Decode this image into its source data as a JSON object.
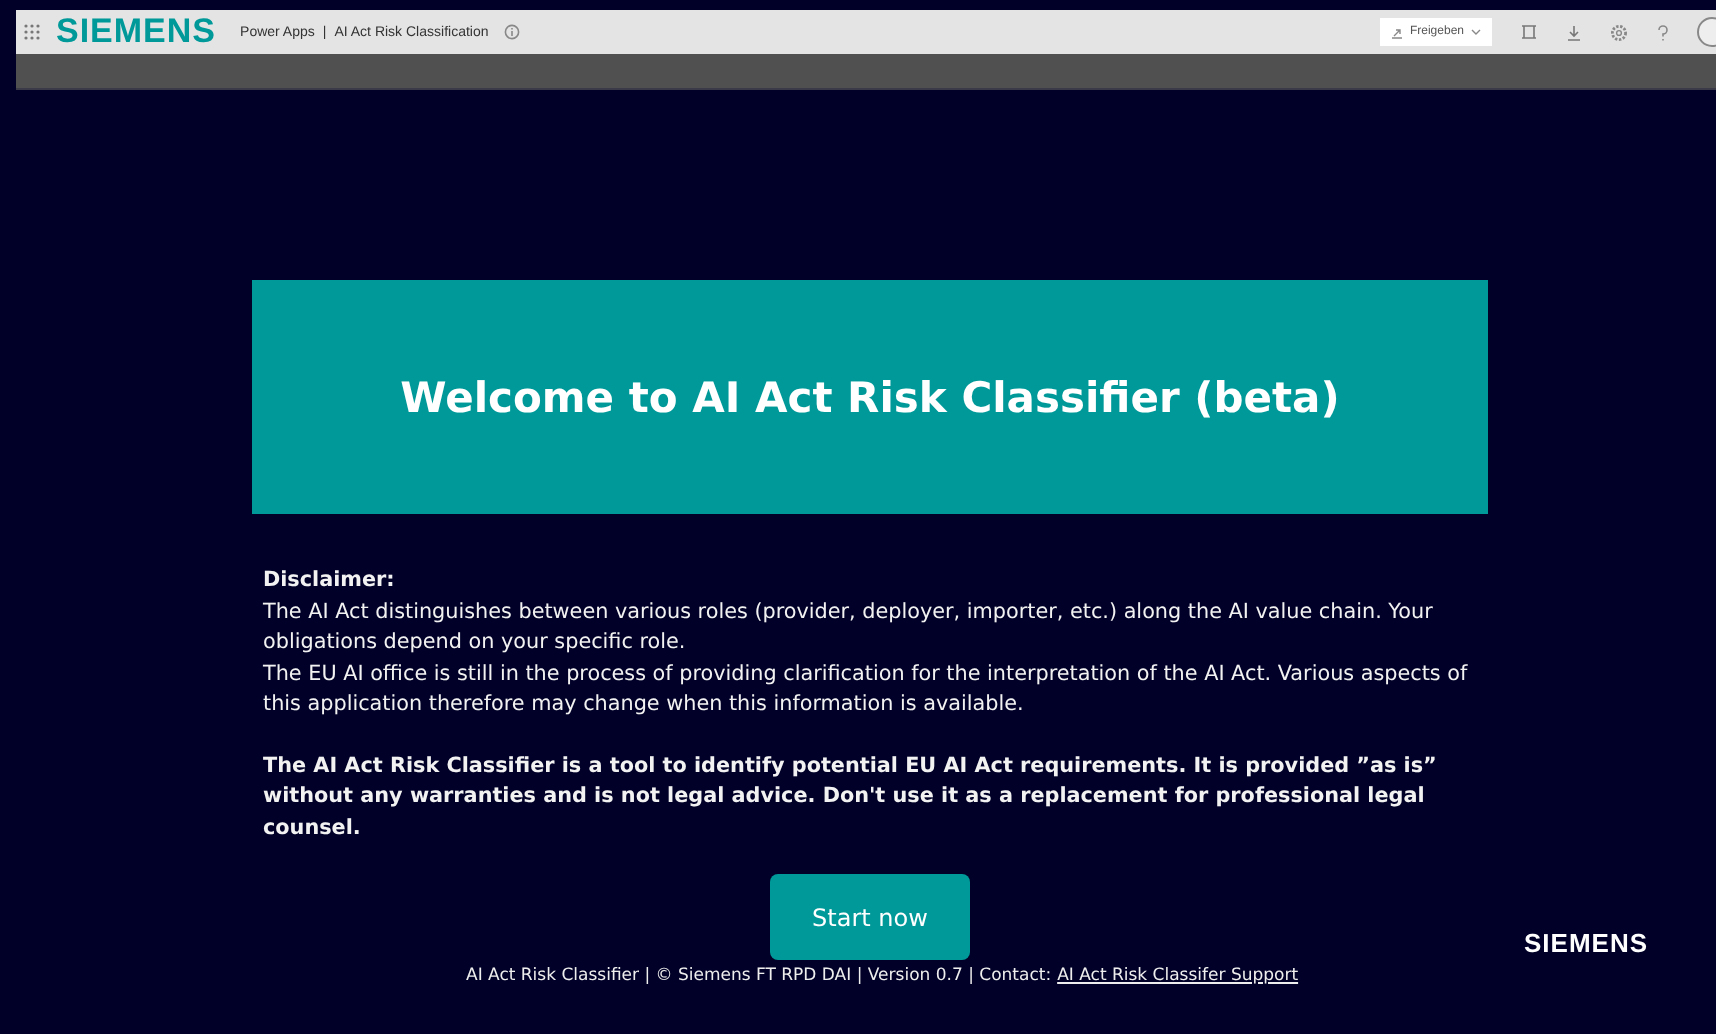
{
  "top_bar": {
    "logo": "SIEMENS",
    "breadcrumb": {
      "product": "Power Apps",
      "separator": "|",
      "app": "AI Act Risk Classification"
    },
    "share_button": "Freigeben"
  },
  "banner": {
    "title": "Welcome to AI Act Risk Classifier (beta)"
  },
  "disclaimer": {
    "heading": "Disclaimer:",
    "paragraphs": [
      "The AI Act distinguishes between various roles (provider, deployer, importer, etc.) along the AI value chain. Your obligations depend on your specific role.",
      "The EU AI office is still in the process of providing clarification for the interpretation of the AI Act. Various aspects of this application therefore may change when this information is available."
    ],
    "notice": "The AI Act Risk Classifier is a tool to identify potential EU AI Act requirements. It is provided ”as is” without any warranties and is not legal advice. Don't use it as a replacement for professional legal counsel."
  },
  "start_button": "Start now",
  "brand": "SIEMENS",
  "footer": {
    "text": "AI Act Risk Classifier | © Siemens FT RPD DAI | Version 0.7 | Contact:",
    "link": "AI Act Risk Classifer Support"
  }
}
